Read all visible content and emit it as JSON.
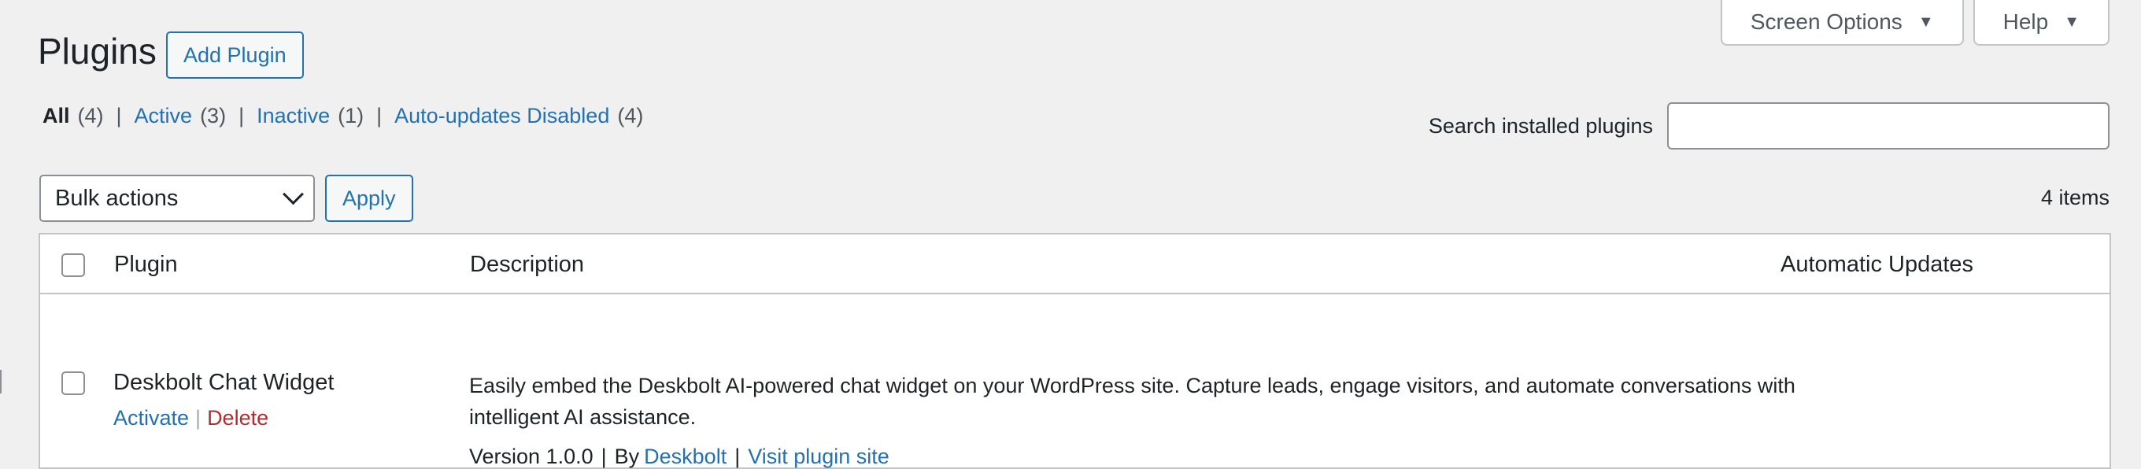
{
  "screen_meta": {
    "screen_options_label": "Screen Options",
    "help_label": "Help"
  },
  "header": {
    "title": "Plugins",
    "add_new_label": "Add Plugin"
  },
  "filters": [
    {
      "label": "All",
      "count": "(4)"
    },
    {
      "label": "Active",
      "count": "(3)"
    },
    {
      "label": "Inactive",
      "count": "(1)"
    },
    {
      "label": "Auto-updates Disabled",
      "count": "(4)"
    }
  ],
  "filter_separator": "|",
  "search": {
    "label": "Search installed plugins",
    "value": "",
    "placeholder": ""
  },
  "bulk": {
    "selected": "Bulk actions",
    "apply_label": "Apply"
  },
  "items_count": "4 items",
  "table": {
    "columns": [
      "Plugin",
      "Description",
      "Automatic Updates"
    ],
    "rows": [
      {
        "name": "Deskbolt Chat Widget",
        "actions": [
          "Activate",
          "Delete"
        ],
        "description": "Easily embed the Deskbolt AI-powered chat widget on your WordPress site. Capture leads, engage visitors, and automate conversations with intelligent AI assistance.",
        "version": "Version 1.0.0",
        "by_label": "By",
        "author": "Deskbolt",
        "visit_label": "Visit plugin site",
        "separator": "|"
      }
    ]
  },
  "colors": {
    "background": "#f0f0f1",
    "link": "#2271b1",
    "delete": "#b32d2e",
    "text": "#1d2327",
    "border": "#c3c4c7"
  }
}
